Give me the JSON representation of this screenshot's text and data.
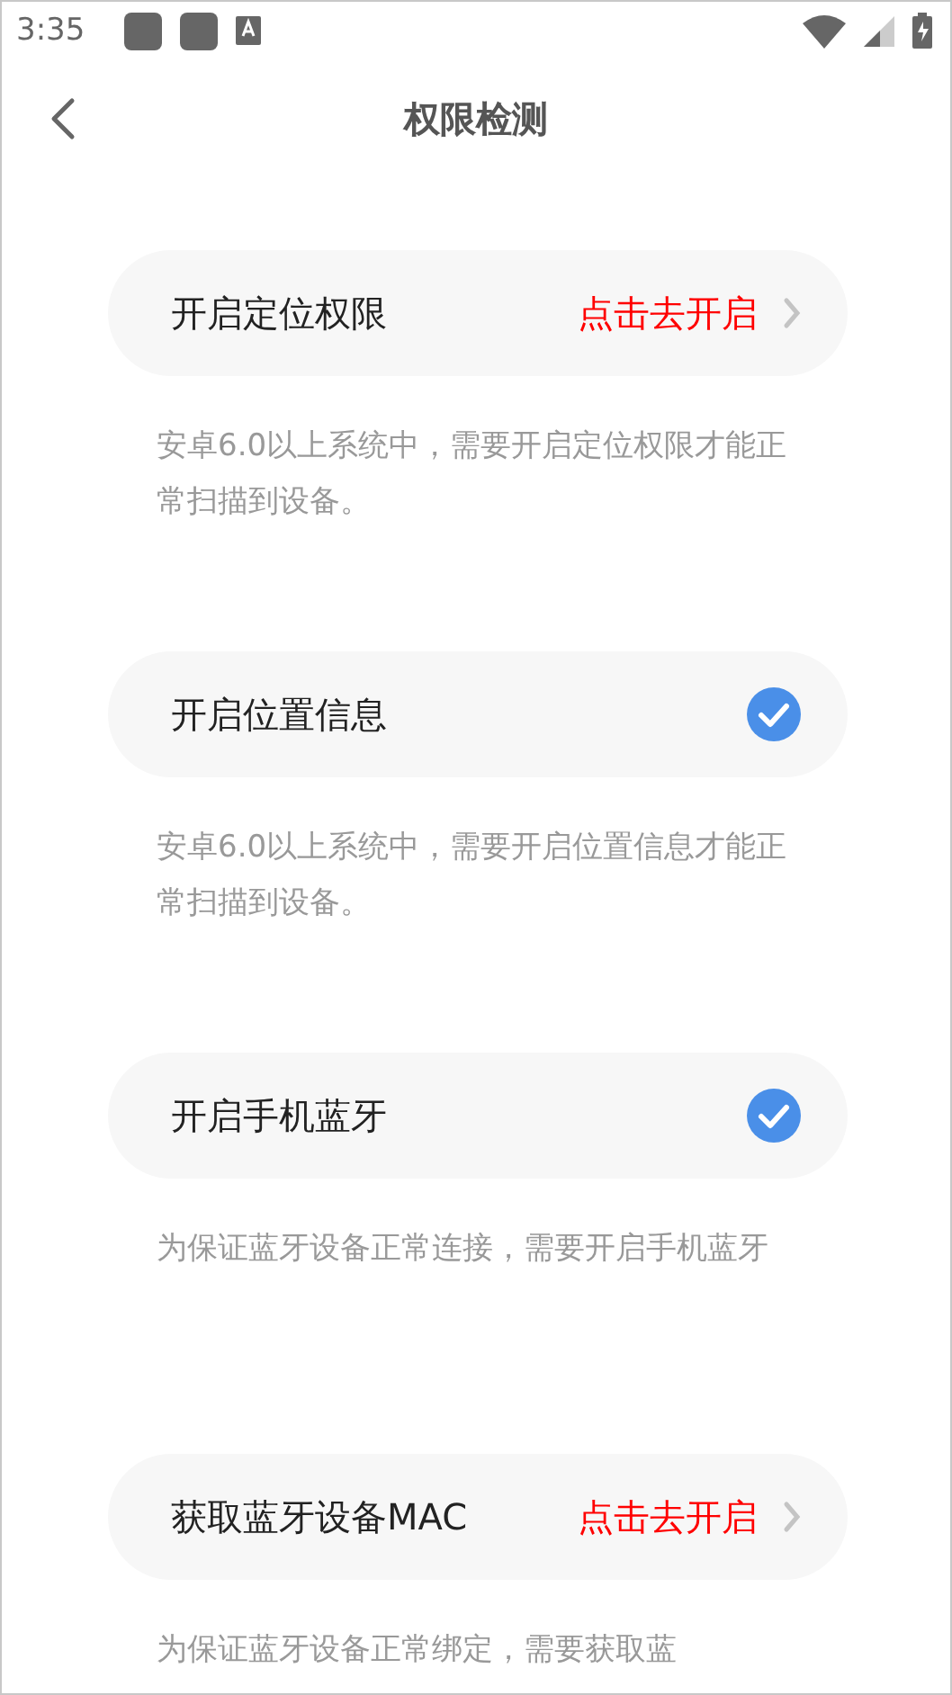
{
  "status_bar": {
    "time": "3:35"
  },
  "header": {
    "title": "权限检测"
  },
  "items": [
    {
      "kind": "action",
      "label": "开启定位权限",
      "action_label": "点击去开启",
      "description": "安卓6.0以上系统中，需要开启定位权限才能正常扫描到设备。"
    },
    {
      "kind": "status",
      "label": "开启位置信息",
      "checked": true,
      "description": "安卓6.0以上系统中，需要开启位置信息才能正常扫描到设备。"
    },
    {
      "kind": "status",
      "label": "开启手机蓝牙",
      "checked": true,
      "description": "为保证蓝牙设备正常连接，需要开启手机蓝牙"
    },
    {
      "kind": "action",
      "label": "获取蓝牙设备MAC",
      "action_label": "点击去开启",
      "description": "为保证蓝牙设备正常绑定，需要获取蓝"
    }
  ]
}
